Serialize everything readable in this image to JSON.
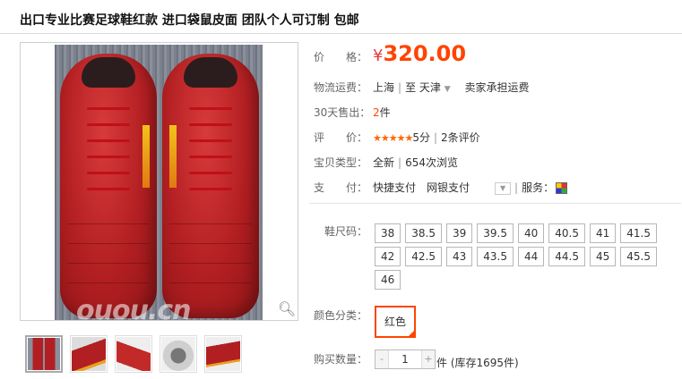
{
  "title": "出口专业比赛足球鞋红款 进口袋鼠皮面 团队个人可订制 包邮",
  "price": {
    "label": "价　　格：",
    "currency": "¥",
    "value": "320.00"
  },
  "shipping": {
    "label": "物流运费：",
    "from": "上海",
    "to_word": "至",
    "to": "天津",
    "seller_pays": "卖家承担运费"
  },
  "sold": {
    "label": "30天售出：",
    "count": "2",
    "unit": "件"
  },
  "rating": {
    "label": "评　　价：",
    "stars": "★★★★★",
    "score": "5分",
    "reviews": "2条评价"
  },
  "type": {
    "label": "宝贝类型：",
    "condition": "全新",
    "views": "654次浏览"
  },
  "payment": {
    "label": "支　　付：",
    "methods": "快捷支付　网银支付",
    "service_label": "服务："
  },
  "sizes": {
    "label": "鞋尺码：",
    "options": [
      "38",
      "38.5",
      "39",
      "39.5",
      "40",
      "40.5",
      "41",
      "41.5",
      "42",
      "42.5",
      "43",
      "43.5",
      "44",
      "44.5",
      "45",
      "45.5",
      "46"
    ]
  },
  "color": {
    "label": "颜色分类：",
    "selected": "红色"
  },
  "quantity": {
    "label": "购买数量：",
    "minus": "-",
    "value": "1",
    "plus": "+",
    "stock": "件 (库存1695件)"
  },
  "watermark": "ouou.cn",
  "colors": {
    "price": "#ff4400",
    "accent": "#ff6600",
    "shoe_red": "#b21f22"
  }
}
